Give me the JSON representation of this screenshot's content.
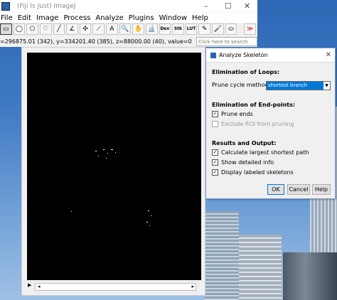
{
  "fiji_window": {
    "title": "(Fiji Is Just) ImageJ",
    "window_controls": {
      "minimize": "–",
      "maximize": "☐",
      "close": "✕"
    },
    "menu": [
      "File",
      "Edit",
      "Image",
      "Process",
      "Analyze",
      "Plugins",
      "Window",
      "Help"
    ],
    "tools": [
      {
        "icon": "rectangle-tool-icon",
        "glyph": "▭",
        "active": true
      },
      {
        "icon": "oval-tool-icon",
        "glyph": "◯"
      },
      {
        "icon": "polygon-tool-icon",
        "glyph": "⬠"
      },
      {
        "icon": "freehand-tool-icon",
        "glyph": "♡"
      },
      {
        "icon": "line-tool-icon",
        "glyph": "╱"
      },
      {
        "icon": "angle-tool-icon",
        "glyph": "∠"
      },
      {
        "icon": "point-tool-icon",
        "glyph": "✣"
      },
      {
        "icon": "wand-tool-icon",
        "glyph": "⟋"
      },
      {
        "icon": "text-tool-icon",
        "glyph": "A"
      },
      {
        "icon": "zoom-tool-icon",
        "glyph": "🔍"
      },
      {
        "icon": "hand-tool-icon",
        "glyph": "✋"
      },
      {
        "icon": "dropper-tool-icon",
        "glyph": "🔬"
      },
      {
        "icon": "developer-menu-icon",
        "glyph": "Dev"
      },
      {
        "icon": "stacks-menu-icon",
        "glyph": "Stk"
      },
      {
        "icon": "lut-menu-icon",
        "glyph": "LUT"
      },
      {
        "icon": "pencil-tool-icon",
        "glyph": "✎"
      },
      {
        "icon": "brush-tool-icon",
        "glyph": "🖌"
      },
      {
        "icon": "flood-fill-tool-icon",
        "glyph": "⛀"
      },
      {
        "icon": "more-tools-icon",
        "glyph": "≫"
      }
    ],
    "status_text": "=296875.01 (342), y=334201.40 (385), z=88000.00 (40), value=0",
    "search_placeholder": "Click here to search"
  },
  "image_window": {
    "scroll_left": "◂",
    "scroll_right": "▸",
    "play": "▶"
  },
  "dialog": {
    "title": "Analyze Skeleton",
    "close": "✕",
    "loops_heading": "Elimination of Loops:",
    "prune_label": "Prune cycle method:",
    "prune_value": "shortest branch",
    "endpoints_heading": "Elimination of End-points:",
    "prune_ends": {
      "label": "Prune ends",
      "checked": "✓"
    },
    "exclude_roi": {
      "label": "Exclude ROI from pruning",
      "checked": ""
    },
    "results_heading": "Results and Output:",
    "calc_largest": {
      "label": "Calculate largest shortest path",
      "checked": "✓"
    },
    "show_detailed": {
      "label": "Show detailed info",
      "checked": "✓"
    },
    "display_labeled": {
      "label": "Display labeled skeletons",
      "checked": "✓"
    },
    "buttons": {
      "ok": "OK",
      "cancel": "Cancel",
      "help": "Help"
    }
  }
}
